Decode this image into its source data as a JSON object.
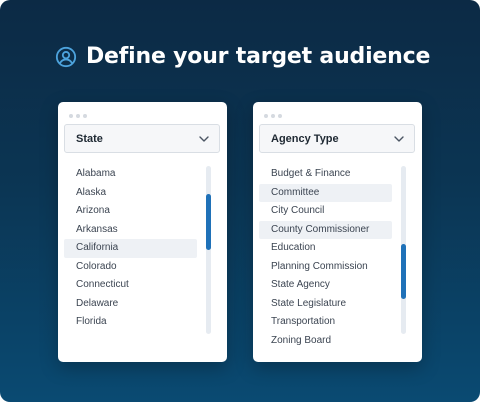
{
  "heading": {
    "title": "Define your target audience",
    "icon": "user-circle-icon"
  },
  "colors": {
    "accent": "#1f71b8",
    "icon": "#4da3dd",
    "background_top": "#0c2a45",
    "background_bottom": "#0a4a72"
  },
  "state_panel": {
    "selected": "State",
    "items": [
      {
        "label": "Alabama",
        "highlight": false
      },
      {
        "label": "Alaska",
        "highlight": false
      },
      {
        "label": "Arizona",
        "highlight": false
      },
      {
        "label": "Arkansas",
        "highlight": false
      },
      {
        "label": "California",
        "highlight": true
      },
      {
        "label": "Colorado",
        "highlight": false
      },
      {
        "label": "Connecticut",
        "highlight": false
      },
      {
        "label": "Delaware",
        "highlight": false
      },
      {
        "label": "Florida",
        "highlight": false
      }
    ],
    "scroll_position": 0.25,
    "scroll_visible_fraction": 0.33
  },
  "agency_panel": {
    "selected": "Agency Type",
    "items": [
      {
        "label": "Budget & Finance",
        "highlight": false
      },
      {
        "label": "Committee",
        "highlight": true
      },
      {
        "label": "City Council",
        "highlight": false
      },
      {
        "label": "County Commissioner",
        "highlight": true
      },
      {
        "label": "Education",
        "highlight": false
      },
      {
        "label": "Planning Commission",
        "highlight": false
      },
      {
        "label": "State Agency",
        "highlight": false
      },
      {
        "label": "State Legislature",
        "highlight": false
      },
      {
        "label": "Transportation",
        "highlight": false
      },
      {
        "label": "Zoning Board",
        "highlight": false
      }
    ],
    "scroll_position": 0.69,
    "scroll_visible_fraction": 0.33
  }
}
